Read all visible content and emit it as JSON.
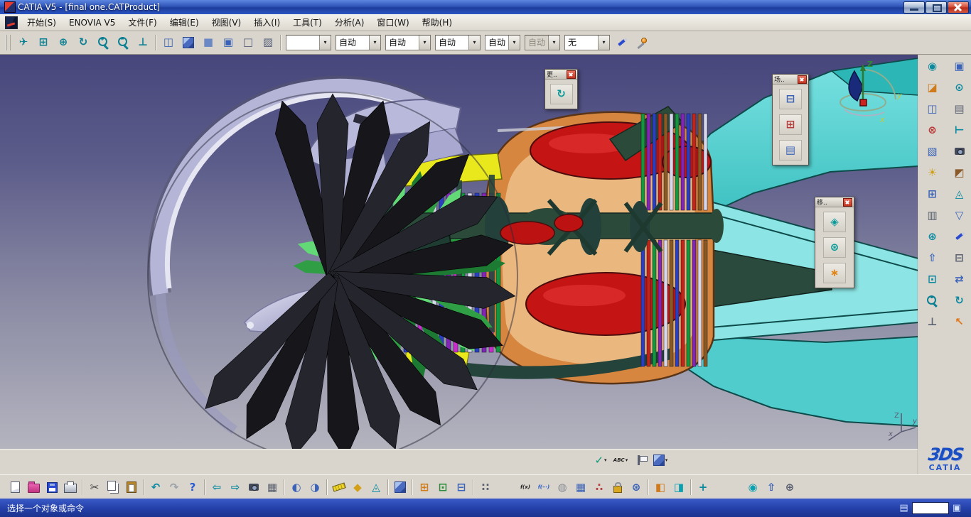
{
  "window": {
    "title": "CATIA V5 - [final one.CATProduct]"
  },
  "ui": {
    "caret": "▾"
  },
  "menubar": {
    "items": [
      "开始(S)",
      "ENOVIA V5",
      "文件(F)",
      "编辑(E)",
      "视图(V)",
      "插入(I)",
      "工具(T)",
      "分析(A)",
      "窗口(W)",
      "帮助(H)"
    ]
  },
  "top_toolbar": {
    "icons": [
      {
        "name": "fly-mode-icon",
        "glyph": "✈",
        "color": "#0b7f93"
      },
      {
        "name": "fit-all-icon",
        "glyph": "⊞",
        "color": "#0b7f93"
      },
      {
        "name": "pan-icon",
        "glyph": "⊕",
        "color": "#0b7f93"
      },
      {
        "name": "rotate-icon",
        "glyph": "↻",
        "color": "#0b7f93"
      },
      {
        "name": "zoom-in-icon",
        "kind": "magp"
      },
      {
        "name": "zoom-out-icon",
        "kind": "magm"
      },
      {
        "name": "normal-view-icon",
        "glyph": "⊥",
        "color": "#0b7f93"
      },
      {
        "sep": true
      },
      {
        "name": "multi-view-icon",
        "glyph": "◫",
        "color": "#3a62b8"
      },
      {
        "name": "iso-view-icon",
        "kind": "cube"
      },
      {
        "name": "shaded-view-icon",
        "glyph": "■",
        "color": "#6a88c4"
      },
      {
        "name": "shaded-edges-icon",
        "glyph": "▣",
        "color": "#3a62b8"
      },
      {
        "name": "wireframe-icon",
        "glyph": "□",
        "color": "#55607a"
      },
      {
        "name": "hidden-line-icon",
        "glyph": "▨",
        "color": "#55607a"
      },
      {
        "sep": true
      }
    ],
    "dropdowns": [
      {
        "name": "line-color-select",
        "value": "",
        "disabled": false
      },
      {
        "name": "fill-color-select",
        "value": "自动",
        "disabled": false
      },
      {
        "name": "line-type-select",
        "value": "自动",
        "disabled": false
      },
      {
        "name": "line-weight-select",
        "value": "自动",
        "disabled": false
      },
      {
        "name": "point-symbol-select",
        "value": "自动",
        "disabled": false
      },
      {
        "name": "render-style-select",
        "value": "自动",
        "disabled": true
      },
      {
        "name": "layer-select",
        "value": "无",
        "disabled": false
      }
    ],
    "after_icons": [
      {
        "name": "graphic-properties-brush-icon",
        "kind": "brush"
      },
      {
        "name": "painter-wizard-icon",
        "kind": "wand"
      }
    ]
  },
  "palettes": {
    "update": {
      "title": "更..",
      "icons": [
        {
          "name": "update-refresh-icon",
          "glyph": "↻",
          "color": "#0a9a9a"
        }
      ]
    },
    "scene": {
      "title": "场..",
      "icons": [
        {
          "name": "enhanced-scene-icon",
          "glyph": "⊟",
          "color": "#3a62b8"
        },
        {
          "name": "scene-browser-icon",
          "glyph": "⊞",
          "color": "#b83a3a"
        },
        {
          "name": "exit-scene-icon",
          "glyph": "▤",
          "color": "#3a62b8"
        }
      ]
    },
    "move": {
      "title": "移..",
      "icons": [
        {
          "name": "manipulation-compass-icon",
          "glyph": "◈",
          "color": "#0a9a9a"
        },
        {
          "name": "snap-gear-icon",
          "glyph": "⊛",
          "color": "#0a9a9a"
        },
        {
          "name": "smart-move-icon",
          "glyph": "∗",
          "color": "#e0851a"
        }
      ]
    }
  },
  "viewport": {
    "compass": {
      "z": "Z",
      "y": "y",
      "x": "x"
    },
    "axis": {
      "z": "Z",
      "y": "y",
      "x": "x"
    },
    "mini_toolbar": [
      {
        "name": "datum-check-icon",
        "glyph": "✓",
        "color": "#0a9a7a",
        "caret": true
      },
      {
        "name": "text-annotation-icon",
        "kind": "text",
        "label": "ABC",
        "color": "#222",
        "caret": true
      },
      {
        "name": "flag-note-icon",
        "kind": "flag",
        "caret": true
      },
      {
        "name": "applied-material-icon",
        "kind": "cube",
        "caret": true
      }
    ]
  },
  "right_dock": {
    "icons": [
      {
        "name": "render-tools-icon",
        "glyph": "◉",
        "color": "#0a8aa0"
      },
      {
        "name": "behavior-icon",
        "glyph": "▣",
        "color": "#3a62b8"
      },
      {
        "name": "simulation-icon",
        "glyph": "◪",
        "color": "#d07a1a"
      },
      {
        "name": "kinematics-icon",
        "glyph": "⊙",
        "color": "#0a8aa0"
      },
      {
        "name": "dmu-review-icon",
        "glyph": "◫",
        "color": "#3a62b8"
      },
      {
        "name": "section-icon",
        "glyph": "▤",
        "color": "#5a6070"
      },
      {
        "name": "clash-icon",
        "glyph": "⊗",
        "color": "#b83a3a"
      },
      {
        "name": "distance-icon",
        "glyph": "⊢",
        "color": "#0a8aa0"
      },
      {
        "name": "annotate-icon",
        "glyph": "▧",
        "color": "#3a62b8"
      },
      {
        "name": "camera-icon",
        "kind": "cam"
      },
      {
        "name": "light-icon",
        "glyph": "☀",
        "color": "#d0a01a"
      },
      {
        "name": "materials-icon",
        "glyph": "◩",
        "color": "#8a5a2a"
      },
      {
        "name": "scene-icon",
        "glyph": "⊞",
        "color": "#3a62b8"
      },
      {
        "name": "measure-dock-icon",
        "glyph": "◬",
        "color": "#0a8aa0"
      },
      {
        "name": "layers-icon",
        "glyph": "▥",
        "color": "#5a6070"
      },
      {
        "name": "filter-icon",
        "glyph": "▽",
        "color": "#3a62b8"
      },
      {
        "name": "gear-icon",
        "glyph": "⊛",
        "color": "#0a8aa0"
      },
      {
        "name": "paint-icon",
        "kind": "brush"
      },
      {
        "name": "publish-icon",
        "glyph": "⇧",
        "color": "#3a62b8"
      },
      {
        "name": "tree-icon",
        "glyph": "⊟",
        "color": "#5a6070"
      },
      {
        "name": "group-icon",
        "glyph": "⊡",
        "color": "#0a8aa0"
      },
      {
        "name": "swap-visible-icon",
        "glyph": "⇄",
        "color": "#3a62b8"
      },
      {
        "name": "zoom-dock-icon",
        "kind": "magp"
      },
      {
        "name": "rotate-dock-icon",
        "glyph": "↻",
        "color": "#0a8aa0"
      },
      {
        "name": "normal-plane-icon",
        "glyph": "⊥",
        "color": "#5a6070"
      },
      {
        "name": "select-arrow-icon",
        "glyph": "↖",
        "color": "#e0761a"
      }
    ]
  },
  "bottom_toolbar": {
    "icons": [
      {
        "name": "new-file-icon",
        "kind": "page"
      },
      {
        "name": "open-file-icon",
        "kind": "folder"
      },
      {
        "name": "save-icon",
        "kind": "save"
      },
      {
        "name": "print-icon",
        "kind": "print"
      },
      {
        "sep": true
      },
      {
        "name": "cut-icon",
        "glyph": "✂",
        "color": "#444"
      },
      {
        "name": "copy-icon",
        "kind": "copy"
      },
      {
        "name": "paste-icon",
        "kind": "paste"
      },
      {
        "sep": true
      },
      {
        "name": "undo-icon",
        "glyph": "↶",
        "color": "#0a8aa0"
      },
      {
        "name": "redo-icon",
        "glyph": "↷",
        "color": "#9aa0a8"
      },
      {
        "name": "help-icon",
        "glyph": "?",
        "color": "#2a5ad0"
      },
      {
        "sep": true
      },
      {
        "name": "fly-back-icon",
        "glyph": "⇦",
        "color": "#0a8aa0"
      },
      {
        "name": "fly-forward-icon",
        "glyph": "⇨",
        "color": "#0a8aa0"
      },
      {
        "name": "camera-view-icon",
        "kind": "cam"
      },
      {
        "name": "view-graph-icon",
        "glyph": "▦",
        "color": "#5a6070"
      },
      {
        "sep": true
      },
      {
        "name": "hide-show-icon",
        "glyph": "◐",
        "color": "#3a62b8"
      },
      {
        "name": "swap-space-icon",
        "glyph": "◑",
        "color": "#3a62b8"
      },
      {
        "sep": true
      },
      {
        "name": "measure-ruler-icon",
        "kind": "ruler"
      },
      {
        "name": "mass-properties-icon",
        "glyph": "◆",
        "color": "#d4a017"
      },
      {
        "name": "measure-item-icon",
        "glyph": "◬",
        "color": "#0a8aa0"
      },
      {
        "sep": true
      },
      {
        "name": "space-cube-icon",
        "kind": "cube"
      },
      {
        "sep": true
      },
      {
        "name": "catalog-icon",
        "glyph": "⊞",
        "color": "#d07a1a"
      },
      {
        "name": "macro-icon",
        "glyph": "⊡",
        "color": "#2a8a3a"
      },
      {
        "name": "options-icon",
        "glyph": "⊟",
        "color": "#3a62b8"
      },
      {
        "sep": true
      },
      {
        "name": "grid-icon",
        "glyph": "∷",
        "color": "#5a6070"
      },
      {
        "gap": 30
      },
      {
        "name": "formula-icon",
        "kind": "text",
        "label": "f(x)",
        "color": "#222"
      },
      {
        "name": "relations-icon",
        "kind": "text",
        "label": "f(⋯)",
        "color": "#2a5ad0"
      },
      {
        "name": "parameter-ball-icon",
        "glyph": "◍",
        "color": "#8a8f98"
      },
      {
        "name": "design-table-icon",
        "glyph": "▦",
        "color": "#3a62b8"
      },
      {
        "name": "network-icon",
        "glyph": "∴",
        "color": "#b83a3a"
      },
      {
        "name": "lock-icon",
        "kind": "lock"
      },
      {
        "name": "gear-pair-icon",
        "glyph": "⊛",
        "color": "#3a62b8"
      },
      {
        "sep": true
      },
      {
        "name": "exit-workbench-icon",
        "glyph": "◧",
        "color": "#d07a1a"
      },
      {
        "name": "enter-workbench-icon",
        "glyph": "◨",
        "color": "#0aa0b0"
      },
      {
        "sep": true
      },
      {
        "name": "snap-target-icon",
        "glyph": "+",
        "color": "#0a8aa0"
      },
      {
        "gap": 44
      },
      {
        "name": "world-icon",
        "glyph": "◉",
        "color": "#0aa0b0"
      },
      {
        "name": "upload-icon",
        "glyph": "⇧",
        "color": "#3a62b8"
      },
      {
        "name": "tools-palette-icon",
        "glyph": "⊕",
        "color": "#5a6070"
      }
    ]
  },
  "brand": {
    "mark": "3DS",
    "name": "CATIA"
  },
  "statusbar": {
    "message": "选择一个对象或命令",
    "input_value": ""
  }
}
